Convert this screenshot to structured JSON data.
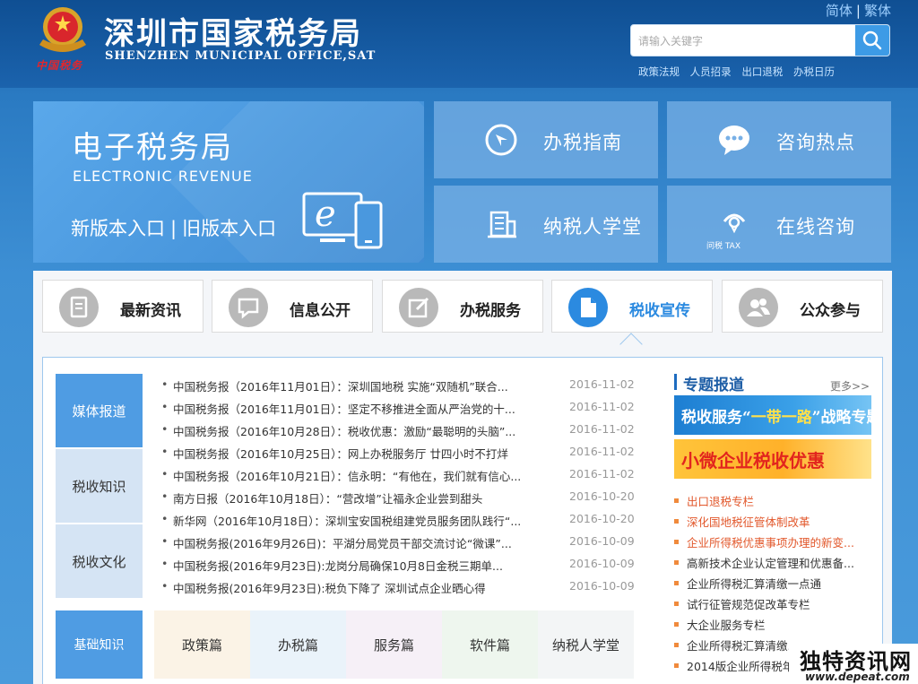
{
  "header": {
    "title": "深圳市国家税务局",
    "subtitle": "SHENZHEN MUNICIPAL OFFICE,SAT",
    "emblem_caption": "中国税务",
    "lang_simplified": "简体",
    "lang_separator": "|",
    "lang_traditional": "繁体",
    "search_placeholder": "请输入关键字",
    "quicklinks": [
      "政策法规",
      "人员招录",
      "出口退税",
      "办税日历"
    ]
  },
  "etax": {
    "title": "电子税务局",
    "subtitle_en": "ELECTRONIC  REVENUE",
    "new_entry": "新版本入口",
    "separator": "|",
    "old_entry": "旧版本入口"
  },
  "tiles": [
    {
      "label": "办税指南",
      "icon": "compass-icon"
    },
    {
      "label": "咨询热点",
      "icon": "chat-bubble-icon"
    },
    {
      "label": "纳税人学堂",
      "icon": "building-icon"
    },
    {
      "label": "在线咨询",
      "icon": "headset-tax-icon",
      "icon_text": "问税 TAX"
    }
  ],
  "main_tabs": [
    {
      "label": "最新资讯",
      "icon": "document-icon",
      "active": false
    },
    {
      "label": "信息公开",
      "icon": "message-icon",
      "active": false
    },
    {
      "label": "办税服务",
      "icon": "edit-icon",
      "active": false
    },
    {
      "label": "税收宣传",
      "icon": "file-icon",
      "active": true
    },
    {
      "label": "公众参与",
      "icon": "people-icon",
      "active": false
    }
  ],
  "side_tabs": [
    {
      "label": "媒体报道",
      "active": true
    },
    {
      "label": "税收知识",
      "active": false
    },
    {
      "label": "税收文化",
      "active": false
    }
  ],
  "news": [
    {
      "text": "中国税务报（2016年11月01日）：深圳国地税 实施“双随机”联合...",
      "date": "2016-11-02"
    },
    {
      "text": "中国税务报（2016年11月01日）：坚定不移推进全面从严治党的十...",
      "date": "2016-11-02"
    },
    {
      "text": "中国税务报（2016年10月28日）：税收优惠：激励“最聪明的头脑”...",
      "date": "2016-11-02"
    },
    {
      "text": "中国税务报（2016年10月25日）：网上办税服务厅 廿四小时不打烊",
      "date": "2016-11-02"
    },
    {
      "text": "中国税务报（2016年10月21日）：信永明：“有他在，我们就有信心...",
      "date": "2016-11-02"
    },
    {
      "text": "南方日报（2016年10月18日）：“营改增”让福永企业尝到甜头",
      "date": "2016-10-20"
    },
    {
      "text": "新华网（2016年10月18日）：深圳宝安国税组建党员服务团队践行“...",
      "date": "2016-10-20"
    },
    {
      "text": "中国税务报(2016年9月26日)：平湖分局党员干部交流讨论“微课”...",
      "date": "2016-10-09"
    },
    {
      "text": "中国税务报(2016年9月23日):龙岗分局确保10月8日金税三期单...",
      "date": "2016-10-09"
    },
    {
      "text": "中国税务报(2016年9月23日):税负下降了 深圳试点企业晒心得",
      "date": "2016-10-09"
    }
  ],
  "basic": {
    "label": "基础知识",
    "categories": [
      {
        "label": "政策篇",
        "color": "#fbf3e6"
      },
      {
        "label": "办税篇",
        "color": "#eaf3fa"
      },
      {
        "label": "服务篇",
        "color": "#f6f0f7"
      },
      {
        "label": "软件篇",
        "color": "#eef6ee"
      },
      {
        "label": "纳税人学堂",
        "color": "#f3f5f6"
      }
    ]
  },
  "special": {
    "title": "专题报道",
    "more": "更多>>",
    "banner1_a": "税收服务“",
    "banner1_b": "一带一路",
    "banner1_c": "”战略专题",
    "banner2": "小微企业税收优惠",
    "items": [
      {
        "text": "出口退税专栏",
        "color": "#e2582c"
      },
      {
        "text": "深化国地税征管体制改革",
        "color": "#e2582c"
      },
      {
        "text": "企业所得税优惠事项办理的新变...",
        "color": "#e2582c"
      },
      {
        "text": "高新技术企业认定管理和优惠备...",
        "color": "#333333"
      },
      {
        "text": "企业所得税汇算清缴一点通",
        "color": "#333333"
      },
      {
        "text": "试行征管规范促改革专栏",
        "color": "#333333"
      },
      {
        "text": "大企业服务专栏",
        "color": "#333333"
      },
      {
        "text": "企业所得税汇算清缴...",
        "color": "#333333"
      },
      {
        "text": "2014版企业所得税年度...",
        "color": "#333333"
      }
    ]
  },
  "watermark": {
    "cn": "独特资讯网",
    "url": "www.depeat.com"
  }
}
